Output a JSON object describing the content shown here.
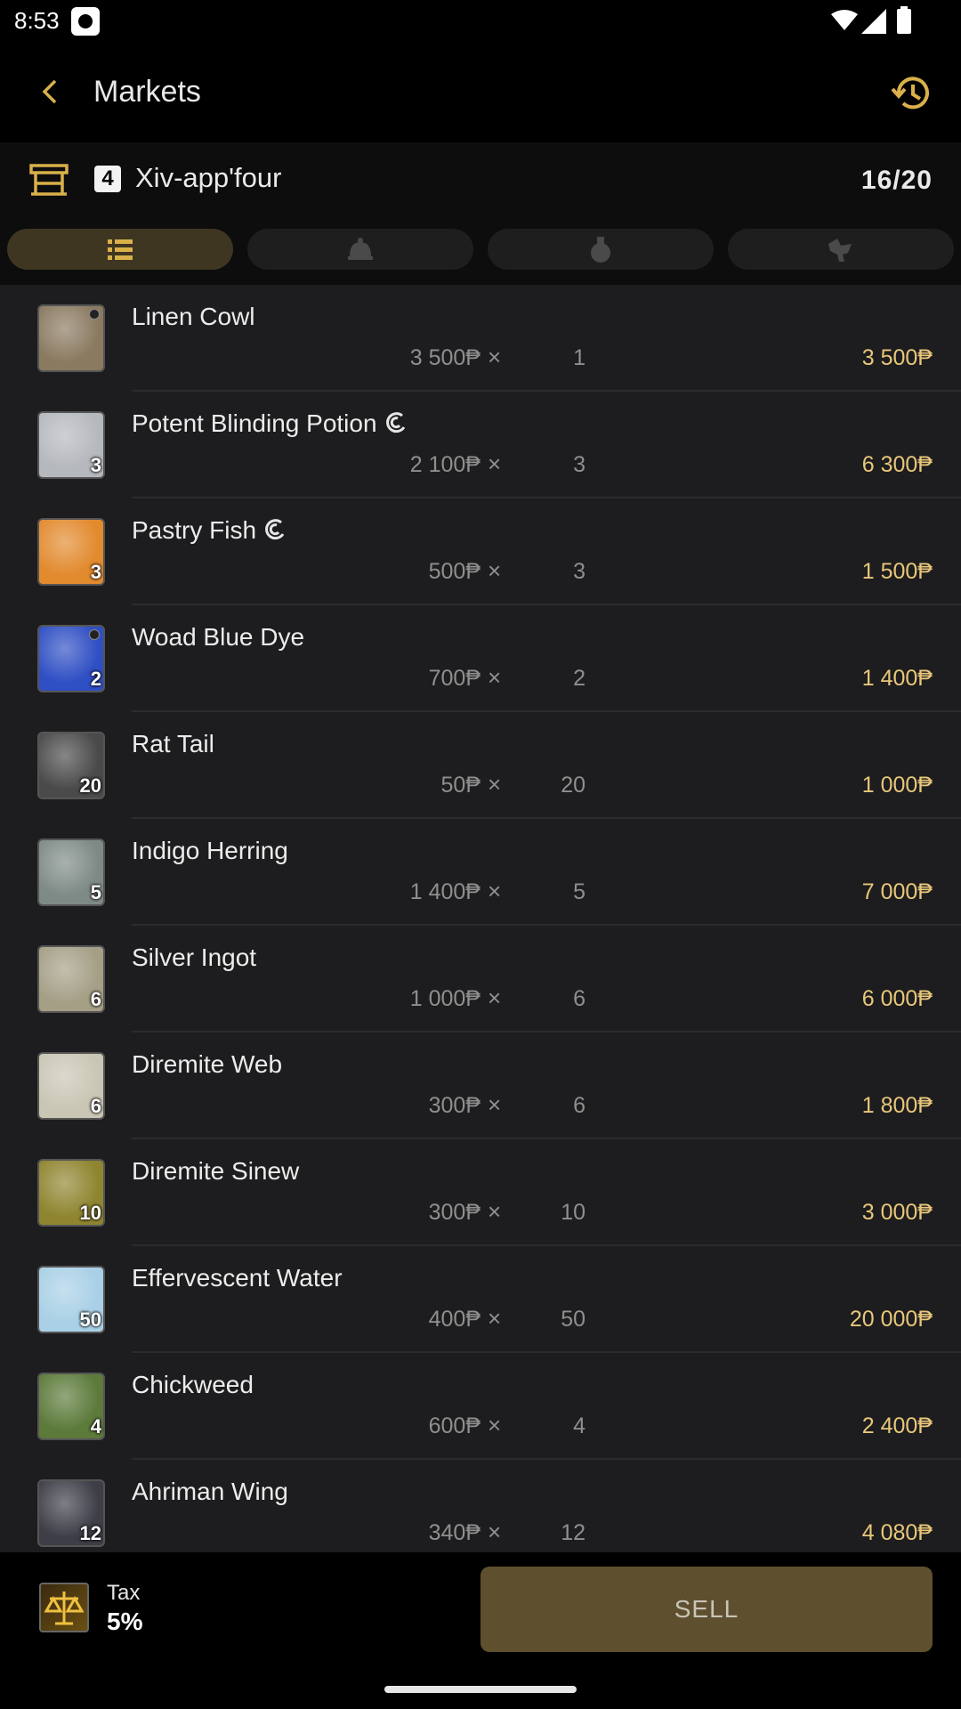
{
  "status_bar": {
    "time": "8:53"
  },
  "app_bar": {
    "title": "Markets"
  },
  "retainer": {
    "badge": "4",
    "name": "Xiv-app'four",
    "count": "16/20"
  },
  "tabs": [
    {
      "icon": "list-icon",
      "active": true
    },
    {
      "icon": "bell-icon",
      "active": false
    },
    {
      "icon": "flask-icon",
      "active": false
    },
    {
      "icon": "chocobo-icon",
      "active": false
    }
  ],
  "items": [
    {
      "name": "Linen Cowl",
      "qty": "",
      "hq": false,
      "hq_dot": true,
      "price": "3 500₱",
      "count": "1",
      "total": "3 500₱",
      "color": "#8a7a60"
    },
    {
      "name": "Potent Blinding Potion",
      "qty": "3",
      "hq": true,
      "hq_dot": false,
      "price": "2 100₱",
      "count": "3",
      "total": "6 300₱",
      "color": "#b5b8bd"
    },
    {
      "name": "Pastry Fish",
      "qty": "3",
      "hq": true,
      "hq_dot": false,
      "price": "500₱",
      "count": "3",
      "total": "1 500₱",
      "color": "#e28a2e"
    },
    {
      "name": "Woad Blue Dye",
      "qty": "2",
      "hq": false,
      "hq_dot": true,
      "price": "700₱",
      "count": "2",
      "total": "1 400₱",
      "color": "#2f4fc4"
    },
    {
      "name": "Rat Tail",
      "qty": "20",
      "hq": false,
      "hq_dot": false,
      "price": "50₱",
      "count": "20",
      "total": "1 000₱",
      "color": "#4a4a4a"
    },
    {
      "name": "Indigo Herring",
      "qty": "5",
      "hq": false,
      "hq_dot": false,
      "price": "1 400₱",
      "count": "5",
      "total": "7 000₱",
      "color": "#7e8a86"
    },
    {
      "name": "Silver Ingot",
      "qty": "6",
      "hq": false,
      "hq_dot": false,
      "price": "1 000₱",
      "count": "6",
      "total": "6 000₱",
      "color": "#a59f86"
    },
    {
      "name": "Diremite Web",
      "qty": "6",
      "hq": false,
      "hq_dot": false,
      "price": "300₱",
      "count": "6",
      "total": "1 800₱",
      "color": "#c9c6b5"
    },
    {
      "name": "Diremite Sinew",
      "qty": "10",
      "hq": false,
      "hq_dot": false,
      "price": "300₱",
      "count": "10",
      "total": "3 000₱",
      "color": "#8f8530"
    },
    {
      "name": "Effervescent Water",
      "qty": "50",
      "hq": false,
      "hq_dot": false,
      "price": "400₱",
      "count": "50",
      "total": "20 000₱",
      "color": "#a9d0e6"
    },
    {
      "name": "Chickweed",
      "qty": "4",
      "hq": false,
      "hq_dot": false,
      "price": "600₱",
      "count": "4",
      "total": "2 400₱",
      "color": "#5c7a3a"
    },
    {
      "name": "Ahriman Wing",
      "qty": "12",
      "hq": false,
      "hq_dot": false,
      "price": "340₱",
      "count": "12",
      "total": "4 080₱",
      "color": "#3e3e48"
    }
  ],
  "footer": {
    "tax_label": "Tax",
    "tax_value": "5%",
    "sell_label": "SELL"
  },
  "colors": {
    "accent": "#e8c77a",
    "gold_icon": "#d9b04a",
    "sell_bg": "#5e4f2e",
    "tab_active": "#3f3621"
  }
}
